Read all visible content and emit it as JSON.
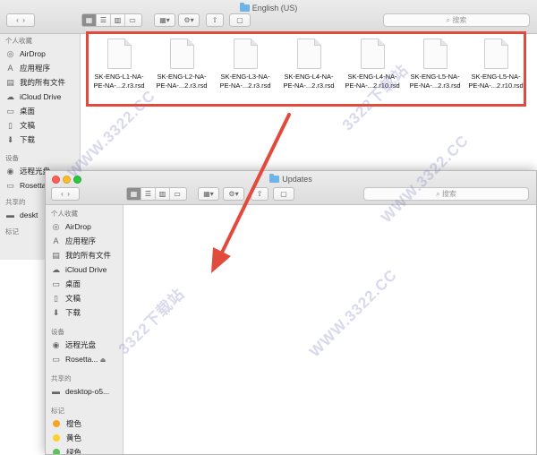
{
  "back_window": {
    "title": "English (US)",
    "search_placeholder": "搜索",
    "sidebar_favorites_header": "个人收藏",
    "sidebar_favorites": [
      {
        "icon": "airdrop-icon",
        "label": "AirDrop"
      },
      {
        "icon": "applications-icon",
        "label": "应用程序"
      },
      {
        "icon": "all-files-icon",
        "label": "我的所有文件"
      },
      {
        "icon": "icloud-icon",
        "label": "iCloud Drive"
      },
      {
        "icon": "desktop-icon",
        "label": "桌面"
      },
      {
        "icon": "documents-icon",
        "label": "文稿"
      },
      {
        "icon": "downloads-icon",
        "label": "下载"
      }
    ],
    "sidebar_devices_header": "设备",
    "sidebar_devices": [
      {
        "icon": "disc-icon",
        "label": "远程光盘"
      },
      {
        "icon": "drive-icon",
        "label": "Rosetta"
      }
    ],
    "sidebar_shared_header": "共享的",
    "sidebar_shared": [
      {
        "icon": "computer-icon",
        "label": "deskt"
      }
    ],
    "sidebar_tags_header": "标记",
    "files": [
      {
        "name": "SK-ENG-L1-NA-\nPE-NA-...2.r3.rsd"
      },
      {
        "name": "SK-ENG-L2-NA-\nPE-NA-...2.r3.rsd"
      },
      {
        "name": "SK-ENG-L3-NA-\nPE-NA-...2.r3.rsd"
      },
      {
        "name": "SK-ENG-L4-NA-\nPE-NA-...2.r3.rsd"
      },
      {
        "name": "SK-ENG-L4-NA-\nPE-NA-...2.r10.rsd"
      },
      {
        "name": "SK-ENG-L5-NA-\nPE-NA-...2.r3.rsd"
      },
      {
        "name": "SK-ENG-L5-NA-\nPE-NA-...2.r10.rsd"
      }
    ]
  },
  "front_window": {
    "title": "Updates",
    "search_placeholder": "搜索",
    "sidebar_favorites_header": "个人收藏",
    "sidebar_favorites": [
      {
        "icon": "airdrop-icon",
        "label": "AirDrop"
      },
      {
        "icon": "applications-icon",
        "label": "应用程序"
      },
      {
        "icon": "all-files-icon",
        "label": "我的所有文件"
      },
      {
        "icon": "icloud-icon",
        "label": "iCloud Drive"
      },
      {
        "icon": "desktop-icon",
        "label": "桌面"
      },
      {
        "icon": "documents-icon",
        "label": "文稿"
      },
      {
        "icon": "downloads-icon",
        "label": "下载"
      }
    ],
    "sidebar_devices_header": "设备",
    "sidebar_devices": [
      {
        "icon": "disc-icon",
        "label": "远程光盘"
      },
      {
        "icon": "drive-icon",
        "label": "Rosetta..."
      }
    ],
    "sidebar_shared_header": "共享的",
    "sidebar_shared": [
      {
        "icon": "computer-icon",
        "label": "desktop-o5..."
      }
    ],
    "sidebar_tags_header": "标记",
    "sidebar_tags": [
      {
        "label": "橙色",
        "color": "#f5a623"
      },
      {
        "label": "黄色",
        "color": "#f8d12f"
      },
      {
        "label": "绿色",
        "color": "#5cc25b"
      }
    ]
  },
  "colors": {
    "highlight_box": "#e24a3b",
    "arrow": "#e24a3b"
  },
  "watermark": {
    "url": "WWW.3322.CC",
    "site": "3322下载站"
  }
}
